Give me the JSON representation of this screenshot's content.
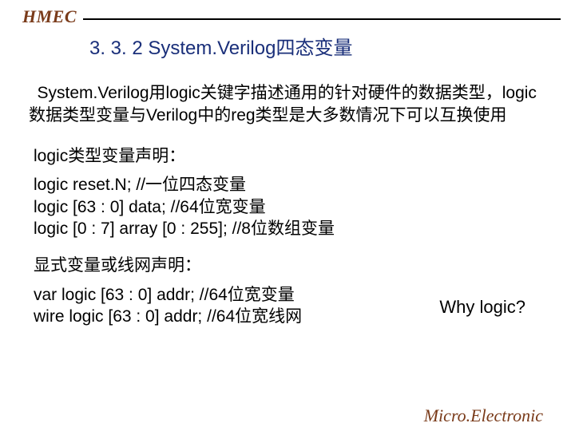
{
  "header": {
    "logo": "HMEC",
    "title": "3. 3. 2 System.Verilog四态变量"
  },
  "para1": "System.Verilog用logic关键字描述通用的针对硬件的数据类型，logic数据类型变量与Verilog中的reg类型是大多数情况下可以互换使用",
  "section_logic_decl": "logic类型变量声明：",
  "code1": {
    "l1": "logic reset.N; //一位四态变量",
    "l2": "logic [63 : 0] data; //64位宽变量",
    "l3": "logic [0 : 7] array [0 : 255]; //8位数组变量"
  },
  "section_explicit": "显式变量或线网声明：",
  "code2": {
    "l1": "var logic [63 : 0] addr;  //64位宽变量",
    "l2": "wire logic [63 : 0] addr; //64位宽线网"
  },
  "why": "Why logic?",
  "footer": "Micro.Electronic"
}
